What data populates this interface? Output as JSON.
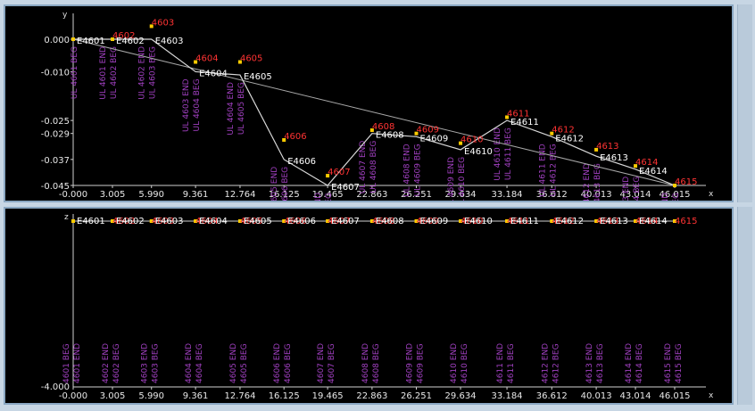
{
  "chart_data": [
    {
      "type": "line",
      "x_axis_label": "x",
      "y_axis_label": "y",
      "x_ticks": [
        "-0.000",
        "3.005",
        "5.990",
        "9.361",
        "12.764",
        "16.125",
        "19.465",
        "22.863",
        "26.251",
        "29.634",
        "33.184",
        "36.612",
        "40.013",
        "43.014",
        "46.015"
      ],
      "y_ticks": [
        "0.000",
        "-0.010",
        "-0.025",
        "-0.029",
        "-0.037",
        "-0.045"
      ],
      "series": [
        {
          "label_color": "#ffffff",
          "points": [
            {
              "x": 0.0,
              "y": 0.0,
              "label": "E4601"
            },
            {
              "x": 3.005,
              "y": 0.0,
              "label": "E4602"
            },
            {
              "x": 5.99,
              "y": 0.0,
              "label": "E4603"
            },
            {
              "x": 9.361,
              "y": -0.01,
              "label": "E4604"
            },
            {
              "x": 12.764,
              "y": -0.011,
              "label": "E4605"
            },
            {
              "x": 16.125,
              "y": -0.037,
              "label": "E4606"
            },
            {
              "x": 19.465,
              "y": -0.045,
              "label": "E4607"
            },
            {
              "x": 22.863,
              "y": -0.029,
              "label": "E4608"
            },
            {
              "x": 26.251,
              "y": -0.03,
              "label": "E4609"
            },
            {
              "x": 29.634,
              "y": -0.034,
              "label": "E4610"
            },
            {
              "x": 33.184,
              "y": -0.025,
              "label": "E4611"
            },
            {
              "x": 36.612,
              "y": -0.03,
              "label": "E4612"
            },
            {
              "x": 40.013,
              "y": -0.036,
              "label": "E4613"
            },
            {
              "x": 43.014,
              "y": -0.04,
              "label": "E4614"
            },
            {
              "x": 46.015,
              "y": -0.045,
              "label": ""
            }
          ]
        },
        {
          "label_color": "#ff3333",
          "points": [
            {
              "x": 0.0,
              "y": 0.0,
              "label": ""
            },
            {
              "x": 3.005,
              "y": 0.0,
              "label": "4602"
            },
            {
              "x": 5.99,
              "y": 0.004,
              "label": "4603"
            },
            {
              "x": 9.361,
              "y": -0.007,
              "label": "4604"
            },
            {
              "x": 12.764,
              "y": -0.007,
              "label": "4605"
            },
            {
              "x": 16.125,
              "y": -0.031,
              "label": "4606"
            },
            {
              "x": 19.465,
              "y": -0.042,
              "label": "4607"
            },
            {
              "x": 22.863,
              "y": -0.028,
              "label": "4608"
            },
            {
              "x": 26.251,
              "y": -0.029,
              "label": "4609"
            },
            {
              "x": 29.634,
              "y": -0.032,
              "label": "4610"
            },
            {
              "x": 33.184,
              "y": -0.024,
              "label": "4611"
            },
            {
              "x": 36.612,
              "y": -0.029,
              "label": "4612"
            },
            {
              "x": 40.013,
              "y": -0.034,
              "label": "4613"
            },
            {
              "x": 43.014,
              "y": -0.039,
              "label": "4614"
            },
            {
              "x": 46.015,
              "y": -0.045,
              "label": "4615"
            }
          ]
        }
      ],
      "secant_line": [
        {
          "x": 0.0,
          "y": 0.0
        },
        {
          "x": 46.015,
          "y": -0.045
        }
      ],
      "vertical_labels": [
        "UL 4601 BEG",
        "UL 4601 END",
        "UL 4602 BEG",
        "UL 4602 END",
        "UL 4603 BEG",
        "UL 4603 END",
        "UL 4604 BEG",
        "UL 4604 END",
        "UL 4605 BEG",
        "UL 4605 END",
        "UL 4606 BEG",
        "UL 4606 END",
        "UL 4607 BEG",
        "UL 4607 END",
        "UL 4608 BEG",
        "UL 4608 END",
        "UL 4609 BEG",
        "UL 4609 END",
        "UL 4610 BEG",
        "UL 4610 END",
        "UL 4611 BEG",
        "UL 4611 END",
        "UL 4612 BEG",
        "UL 4612 END",
        "UL 4613 BEG",
        "UL 4613 END",
        "UL 4614 BEG",
        "UL 4614 END",
        "UL 4615 BEG"
      ]
    },
    {
      "type": "scatter",
      "x_axis_label": "x",
      "y_axis_label": "z",
      "x_ticks": [
        "-0.000",
        "3.005",
        "5.990",
        "9.361",
        "12.764",
        "16.125",
        "19.465",
        "22.863",
        "26.251",
        "29.634",
        "33.184",
        "36.612",
        "40.013",
        "43.014",
        "46.015"
      ],
      "y_ticks": [
        "-4.000"
      ],
      "white_labels": [
        "E4601",
        "E4602",
        "E4603",
        "E4604",
        "E4605",
        "E4606",
        "E4607",
        "E4608",
        "E4609",
        "E4610",
        "E4611",
        "E4612",
        "E4613",
        "E4614",
        ""
      ],
      "red_labels": [
        "",
        "4602",
        "4603",
        "4604",
        "4605",
        "4606",
        "4607",
        "4608",
        "4609",
        "4610",
        "4611",
        "4612",
        "4613",
        "4614",
        "4615"
      ],
      "vertical_labels": [
        "4601 BEG",
        "4601 END",
        "4602 END",
        "4602 BEG",
        "4603 END",
        "4603 BEG",
        "4604 END",
        "4604 BEG",
        "4605 END",
        "4605 BEG",
        "4606 END",
        "4606 BEG",
        "4607 END",
        "4607 BEG",
        "4608 END",
        "4608 BEG",
        "4609 END",
        "4609 BEG",
        "4610 END",
        "4610 BEG",
        "4611 END",
        "4611 BEG",
        "4612 END",
        "4612 BEG",
        "4613 END",
        "4613 BEG",
        "4614 END",
        "4614 BEG",
        "4615 END",
        "4615 BEG"
      ]
    }
  ],
  "colors": {
    "background": "#000000",
    "frame": "#8aa7c2",
    "line": "#d8d8d8",
    "red_label": "#ff3333",
    "white_label": "#ffffff",
    "vertical_label": "#a040c0",
    "marker": "#ffcc00",
    "window": "#c7d6e4"
  }
}
